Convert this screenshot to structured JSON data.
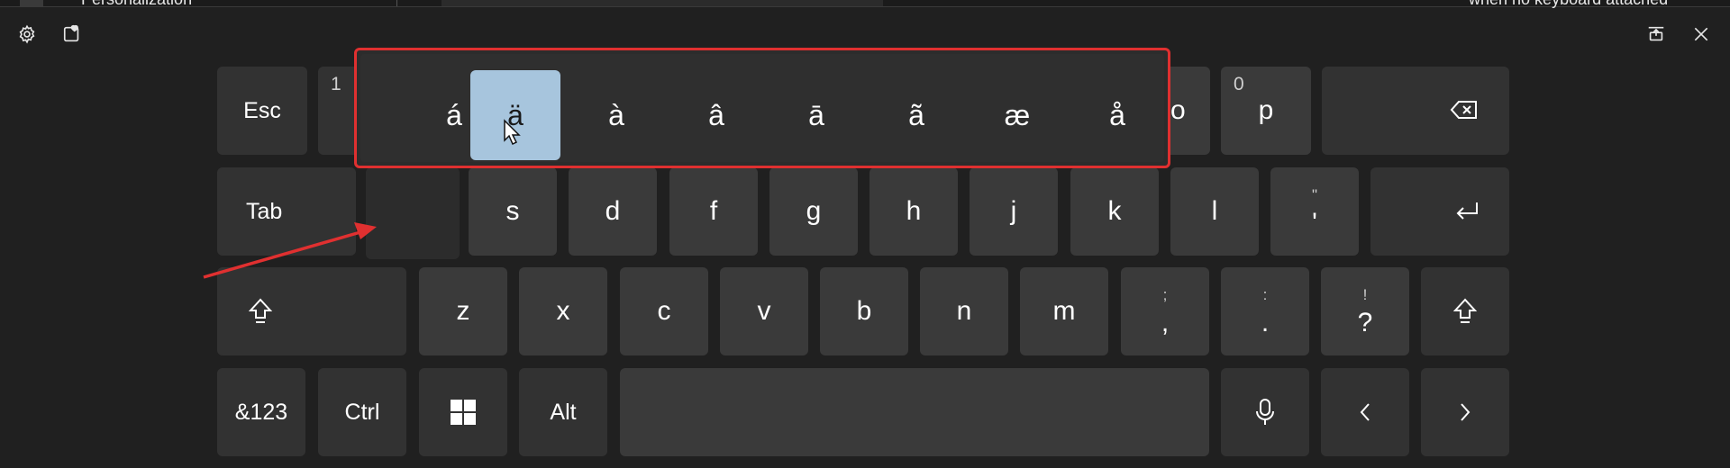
{
  "top_strip": {
    "left_text": "Personalization",
    "right_text": "when no keyboard attached"
  },
  "popup": {
    "options": [
      "á",
      "ä",
      "à",
      "â",
      "ā",
      "ã",
      "æ",
      "å"
    ],
    "selected": "ä"
  },
  "keys": {
    "esc": "Esc",
    "num1": "1",
    "num0": "0",
    "p": "p",
    "partial_o": "o",
    "tab": "Tab",
    "s": "s",
    "d": "d",
    "f": "f",
    "g": "g",
    "h": "h",
    "j": "j",
    "k": "k",
    "l": "l",
    "quote_top": "\"",
    "quote_bot": "'",
    "z": "z",
    "x": "x",
    "c": "c",
    "v": "v",
    "b": "b",
    "n": "n",
    "m": "m",
    "semicolon_top": ";",
    "comma": ",",
    "colon_top": ":",
    "period": ".",
    "excl_top": "!",
    "question": "?",
    "numbers": "&123",
    "ctrl": "Ctrl",
    "alt": "Alt"
  },
  "icons": {
    "settings": "gear-icon",
    "theme": "heart-card-icon",
    "dock": "dock-icon",
    "close": "close-icon",
    "backspace": "backspace-icon",
    "enter": "enter-icon",
    "shift": "shift-icon",
    "windows": "windows-logo-icon",
    "mic": "microphone-icon",
    "left": "chevron-left-icon",
    "right": "chevron-right-icon"
  },
  "colors": {
    "background": "#202020",
    "key": "#3a3a3a",
    "selected": "#a7c5dd",
    "annotation": "#e03030"
  }
}
